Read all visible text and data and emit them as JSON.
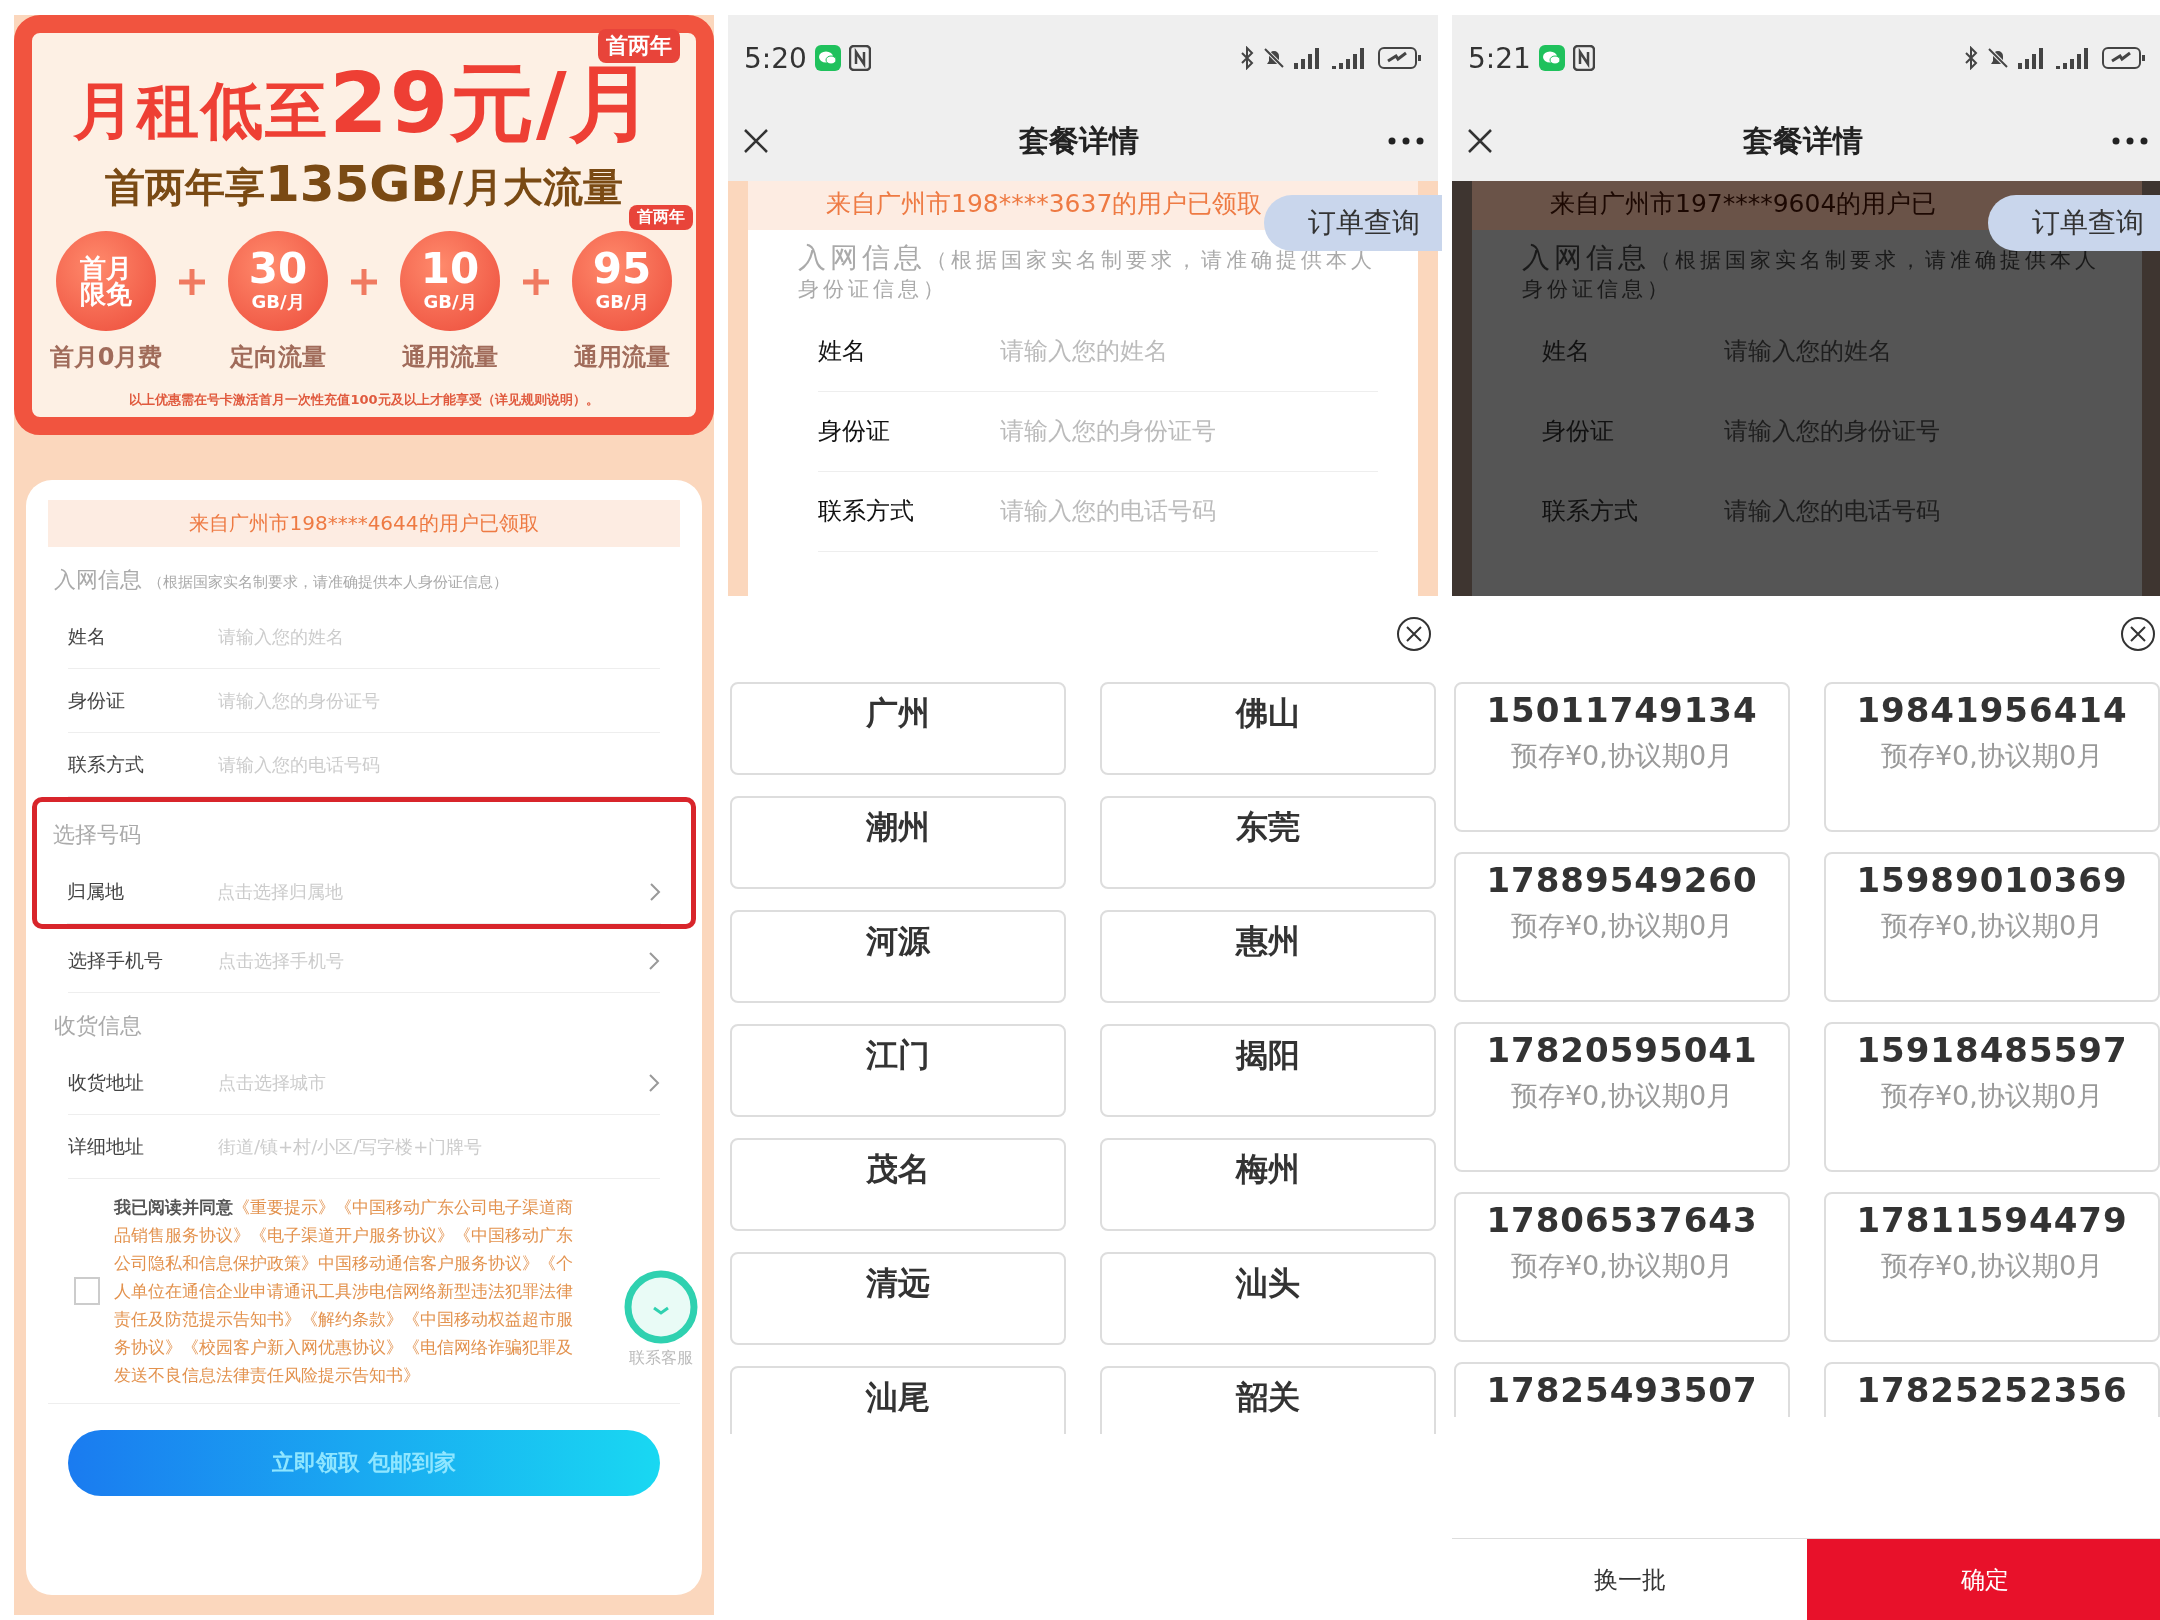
{
  "promo_screen": {
    "banner": {
      "badge": "首两年",
      "headline": "月租低至**29元/月**",
      "subheadline": "首两年享**135GB**/月大流量",
      "perks": [
        {
          "kind": "text",
          "value": "首月限免",
          "label": "首月0月费"
        },
        {
          "kind": "amount",
          "value": "30",
          "unit": "GB/月",
          "label": "定向流量"
        },
        {
          "kind": "amount",
          "value": "10",
          "unit": "GB/月",
          "label": "通用流量"
        },
        {
          "kind": "amount",
          "value": "95",
          "unit": "GB/月",
          "label": "通用流量",
          "badge": "首两年"
        }
      ],
      "footnote": "以上优惠需在号卡激活首月一次性充值100元及以上才能享受（详见规则说明）。"
    },
    "form": {
      "notice": "来自广州市198****4644的用户已领取",
      "sections": [
        {
          "title": "入网信息",
          "note": "（根据国家实名制要求，请准确提供本人身份证信息）",
          "fields": [
            {
              "label": "姓名",
              "placeholder": "请输入您的姓名",
              "kind": "input",
              "highlighted": false
            },
            {
              "label": "身份证",
              "placeholder": "请输入您的身份证号",
              "kind": "input",
              "highlighted": false
            },
            {
              "label": "联系方式",
              "placeholder": "请输入您的电话号码",
              "kind": "input",
              "highlighted": false
            }
          ]
        },
        {
          "title": "选择号码",
          "fields": [
            {
              "label": "归属地",
              "placeholder": "点击选择归属地",
              "kind": "select",
              "highlighted": true
            },
            {
              "label": "选择手机号",
              "placeholder": "点击选择手机号",
              "kind": "select",
              "highlighted": false
            }
          ]
        },
        {
          "title": "收货信息",
          "fields": [
            {
              "label": "收货地址",
              "placeholder": "点击选择城市",
              "kind": "select",
              "highlighted": false
            },
            {
              "label": "详细地址",
              "placeholder": "街道/镇+村/小区/写字楼+门牌号",
              "kind": "input",
              "highlighted": false
            }
          ]
        }
      ],
      "agreement": {
        "checked": false,
        "text": "**我已阅读并同意**《重要提示》《中国移动广东公司电子渠道商品销售服务协议》《电子渠道开户服务协议》《中国移动广东公司隐私和信息保护政策》中国移动通信客户服务协议》《个人单位在通信企业申请通讯工具涉电信网络新型违法犯罪法律责任及防范提示告知书》《解约条款》《中国移动权益超市服务协议》《校园客户新入网优惠协议》《电信网络诈骗犯罪及发送不良信息法律责任风险提示告知书》"
      },
      "chat": {
        "label": "联系客服"
      },
      "submit": "立即领取 包邮到家"
    }
  },
  "city_screen": {
    "status_bar": {
      "time": "5:20"
    },
    "nav": {
      "title": "套餐详情"
    },
    "page": {
      "dimmed": false,
      "notice": "来自广州市198****3637的用户已领取",
      "order_button": "订单查询",
      "section_title": "入网信息",
      "section_note": "（根据国家实名制要求，请准确提供本人身份证信息）",
      "fields": [
        {
          "label": "姓名",
          "placeholder": "请输入您的姓名"
        },
        {
          "label": "身份证",
          "placeholder": "请输入您的身份证号"
        },
        {
          "label": "联系方式",
          "placeholder": "请输入您的电话号码"
        }
      ]
    },
    "picker": {
      "kind": "cities",
      "cities": [
        {
          "name": "广州"
        },
        {
          "name": "佛山"
        },
        {
          "name": "潮州"
        },
        {
          "name": "东莞"
        },
        {
          "name": "河源"
        },
        {
          "name": "惠州"
        },
        {
          "name": "江门"
        },
        {
          "name": "揭阳"
        },
        {
          "name": "茂名"
        },
        {
          "name": "梅州"
        },
        {
          "name": "清远"
        },
        {
          "name": "汕头"
        },
        {
          "name": "汕尾"
        },
        {
          "name": "韶关"
        }
      ]
    }
  },
  "number_screen": {
    "status_bar": {
      "time": "5:21"
    },
    "nav": {
      "title": "套餐详情"
    },
    "page": {
      "dimmed": true,
      "notice": "来自广州市197****9604的用户已",
      "order_button": "订单查询",
      "section_title": "入网信息",
      "section_note": "（根据国家实名制要求，请准确提供本人身份证信息）",
      "fields": [
        {
          "label": "姓名",
          "placeholder": "请输入您的姓名"
        },
        {
          "label": "身份证",
          "placeholder": "请输入您的身份证号"
        },
        {
          "label": "联系方式",
          "placeholder": "请输入您的电话号码"
        }
      ]
    },
    "picker": {
      "kind": "numbers",
      "numbers": [
        {
          "number": "15011749134",
          "terms": "预存¥0,协议期0月"
        },
        {
          "number": "19841956414",
          "terms": "预存¥0,协议期0月"
        },
        {
          "number": "17889549260",
          "terms": "预存¥0,协议期0月"
        },
        {
          "number": "15989010369",
          "terms": "预存¥0,协议期0月"
        },
        {
          "number": "17820595041",
          "terms": "预存¥0,协议期0月"
        },
        {
          "number": "15918485597",
          "terms": "预存¥0,协议期0月"
        },
        {
          "number": "17806537643",
          "terms": "预存¥0,协议期0月"
        },
        {
          "number": "17811594479",
          "terms": "预存¥0,协议期0月"
        },
        {
          "number": "17825493507"
        },
        {
          "number": "17825252356"
        }
      ],
      "refresh": "换一批",
      "confirm": "确定"
    }
  }
}
